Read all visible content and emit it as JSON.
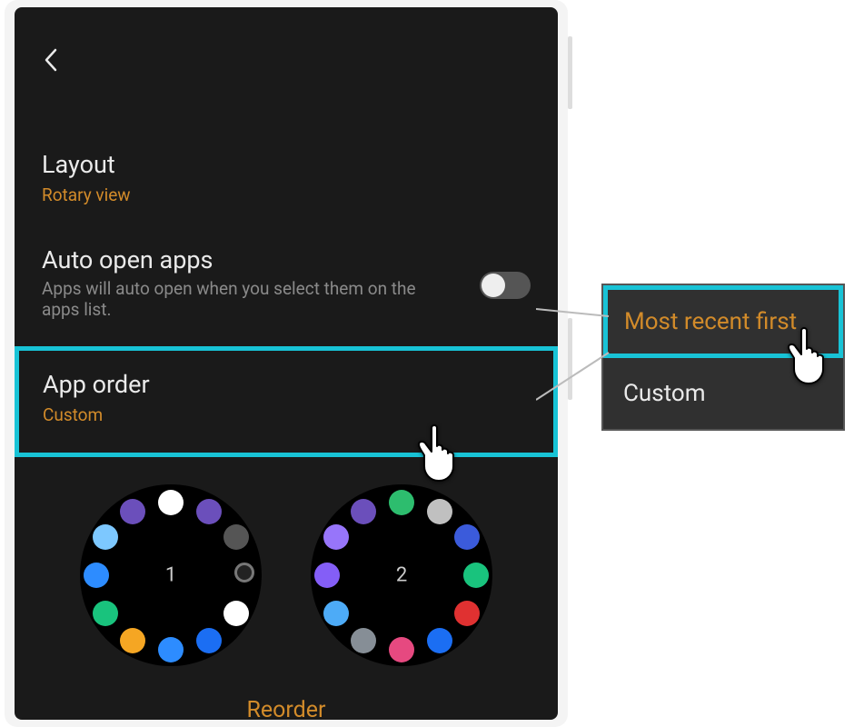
{
  "settings": {
    "layout": {
      "title": "Layout",
      "value": "Rotary view"
    },
    "auto_open": {
      "title": "Auto open apps",
      "desc": "Apps will auto open when you select them on the apps list.",
      "enabled": false
    },
    "app_order": {
      "title": "App order",
      "value": "Custom"
    }
  },
  "watch_pages": [
    {
      "num": "1"
    },
    {
      "num": "2"
    }
  ],
  "reorder_label": "Reorder",
  "popup": {
    "options": [
      {
        "label": "Most recent first",
        "selected": true
      },
      {
        "label": "Custom",
        "selected": false
      }
    ]
  },
  "colors": {
    "accent": "#d28b2a",
    "highlight": "#18c3d6"
  }
}
